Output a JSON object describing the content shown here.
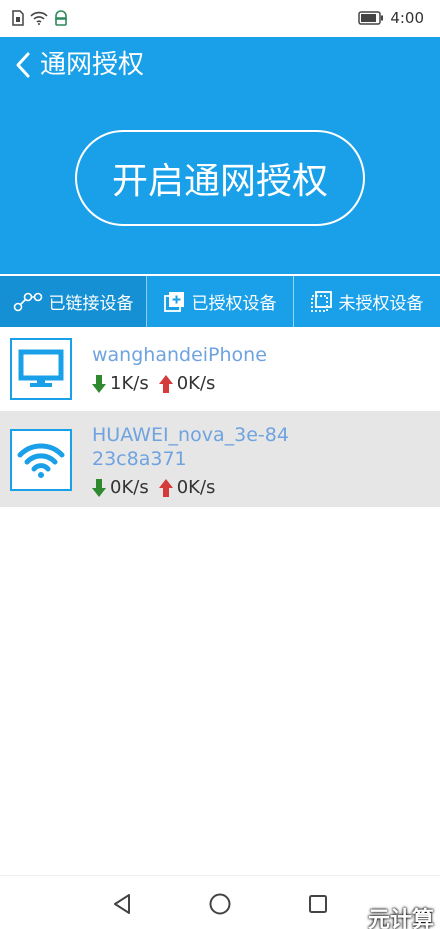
{
  "status_bar": {
    "time": "4:00"
  },
  "header": {
    "title": "通网授权",
    "auth_button_label": "开启通网授权"
  },
  "tabs": [
    {
      "label": "已链接设备",
      "icon": "linked-devices-icon",
      "active": true
    },
    {
      "label": "已授权设备",
      "icon": "authorized-devices-icon",
      "active": false
    },
    {
      "label": "未授权设备",
      "icon": "unauthorized-devices-icon",
      "active": false
    }
  ],
  "devices": [
    {
      "name": "wanghandeiPhone",
      "icon": "monitor-icon",
      "download": "1K/s",
      "upload": "0K/s"
    },
    {
      "name": "HUAWEI_nova_3e-8423c8a371",
      "icon": "wifi-icon",
      "download": "0K/s",
      "upload": "0K/s"
    }
  ],
  "watermark": "元计算",
  "colors": {
    "primary": "#1aa0e8",
    "tab_active": "#1590d4",
    "device_name": "#6fa3e0",
    "download_arrow": "#2f8a2f",
    "upload_arrow": "#d63b3b",
    "selected_row": "#e6e6e6"
  }
}
